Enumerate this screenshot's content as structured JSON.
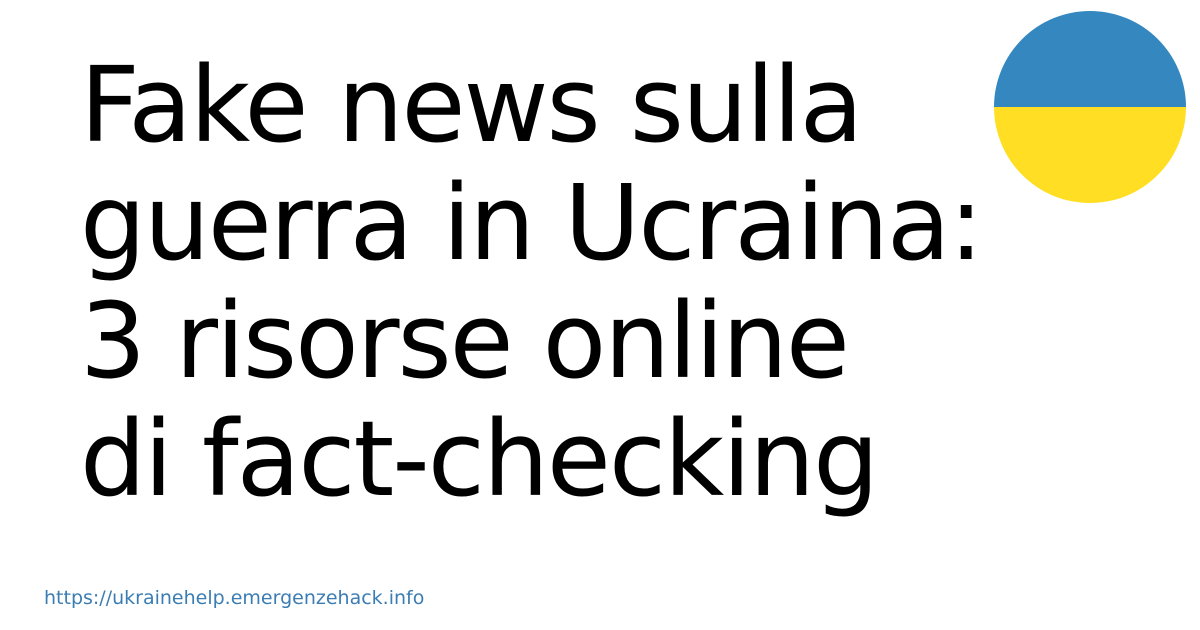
{
  "title": {
    "lines": [
      "Fake news sulla",
      "guerra in Ucraina:",
      "3 risorse online",
      "di fact-checking"
    ]
  },
  "flag": {
    "icon": "ukraine-flag-icon",
    "top_color": "#3588BF",
    "bottom_color": "#FFDE24"
  },
  "footer": {
    "url": "https://ukrainehelp.emergenzehack.info",
    "color": "#3B7DB3"
  }
}
